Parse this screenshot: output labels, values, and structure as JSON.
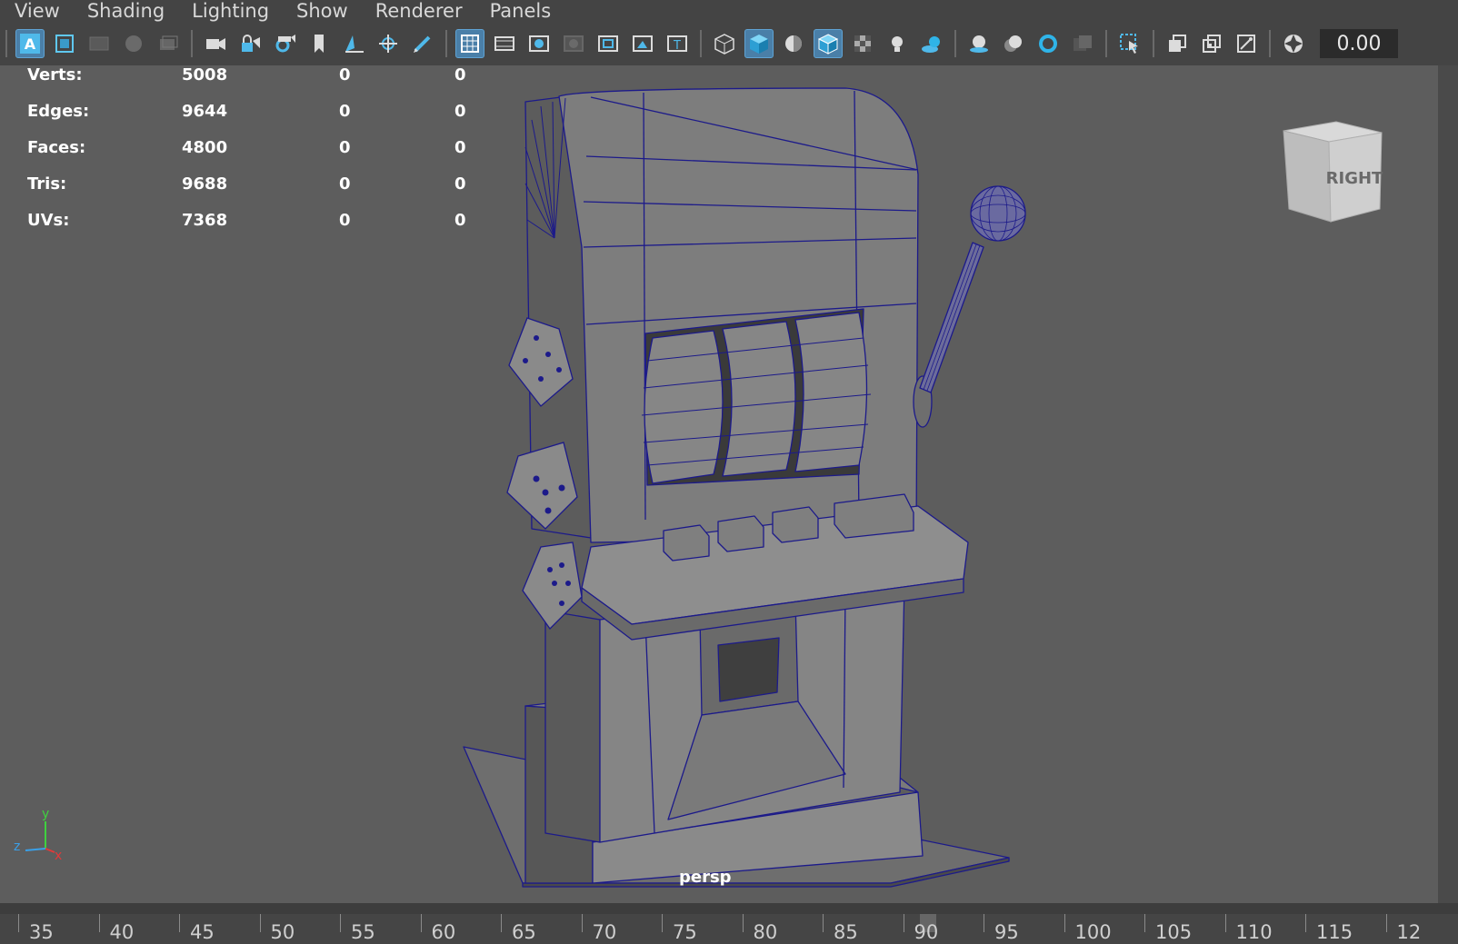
{
  "menubar": {
    "items": [
      "View",
      "Shading",
      "Lighting",
      "Show",
      "Renderer",
      "Panels"
    ]
  },
  "toolbar": {
    "zoom_value": "0.00",
    "icons": [
      "select-camera-icon",
      "camera-attributes-icon",
      "bookmarks-icon",
      "image-plane-icon",
      "grease-pencil-icon",
      "camera-icon",
      "lock-camera-icon",
      "camera-settings-icon",
      "bookmark-icon",
      "2d-pan-zoom-icon",
      "pan-icon",
      "grease-pencil-brush-icon",
      "grid-icon",
      "film-gate-icon",
      "resolution-gate-icon",
      "gate-mask-icon",
      "field-chart-icon",
      "safe-action-icon",
      "safe-title-icon",
      "wireframe-icon",
      "smooth-shade-icon",
      "use-default-material-icon",
      "wireframe-on-shaded-icon",
      "textured-icon",
      "use-all-lights-icon",
      "shadows-icon",
      "screen-space-ao-icon",
      "motion-blur-icon",
      "anti-aliasing-icon",
      "depth-of-field-icon",
      "isolate-select-icon",
      "xray-icon",
      "xray-active-components-icon",
      "xray-joints-icon",
      "color-management-icon"
    ]
  },
  "hud": {
    "rows": [
      {
        "label": "Verts:",
        "v0": "5008",
        "v1": "0",
        "v2": "0"
      },
      {
        "label": "Edges:",
        "v0": "9644",
        "v1": "0",
        "v2": "0"
      },
      {
        "label": "Faces:",
        "v0": "4800",
        "v1": "0",
        "v2": "0"
      },
      {
        "label": "Tris:",
        "v0": "9688",
        "v1": "0",
        "v2": "0"
      },
      {
        "label": "UVs:",
        "v0": "7368",
        "v1": "0",
        "v2": "0"
      }
    ]
  },
  "viewport": {
    "camera_label": "persp",
    "viewcube_label": "RIGHT",
    "axis": {
      "y": "y",
      "z": "z",
      "x": "x"
    }
  },
  "timeline": {
    "ticks": [
      "35",
      "40",
      "45",
      "50",
      "55",
      "60",
      "65",
      "70",
      "75",
      "80",
      "85",
      "90",
      "95",
      "100",
      "105",
      "110",
      "115",
      "12"
    ],
    "current_frame": 90
  },
  "colors": {
    "wire": "#1c1a8a",
    "surface": "#7b7b7b",
    "active_button": "#4a7fa8",
    "axis_y": "#3fd13f",
    "axis_z": "#3aa0e8",
    "axis_x": "#e03a3a"
  }
}
